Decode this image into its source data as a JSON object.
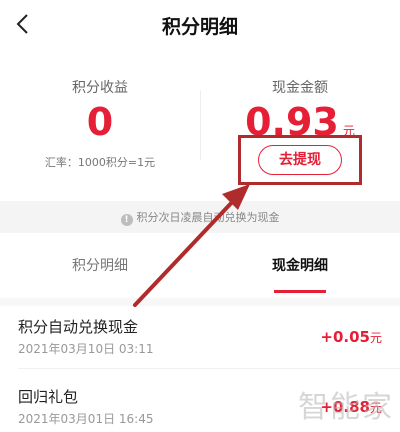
{
  "header": {
    "title": "积分明细"
  },
  "stats": {
    "points_label": "积分收益",
    "points_value": "0",
    "rate_text": "汇率：1000积分=1元",
    "cash_label": "现金金额",
    "cash_value": "0.93",
    "cash_unit": "元",
    "withdraw_label": "去提现"
  },
  "notice": {
    "text": "积分次日凌晨自动兑换为现金",
    "icon": "!"
  },
  "tabs": [
    {
      "label": "积分明细"
    },
    {
      "label": "现金明细"
    }
  ],
  "records": [
    {
      "title": "积分自动兑换现金",
      "date": "2021年03月10日 03:11",
      "amount": "+0.05",
      "unit": "元"
    },
    {
      "title": "回归礼包",
      "date": "2021年03月01日 16:45",
      "amount": "+0.88",
      "unit": "元"
    }
  ],
  "watermark": {
    "text": "智能家"
  },
  "colors": {
    "accent": "#e51f36",
    "annotation": "#b02b2b"
  }
}
